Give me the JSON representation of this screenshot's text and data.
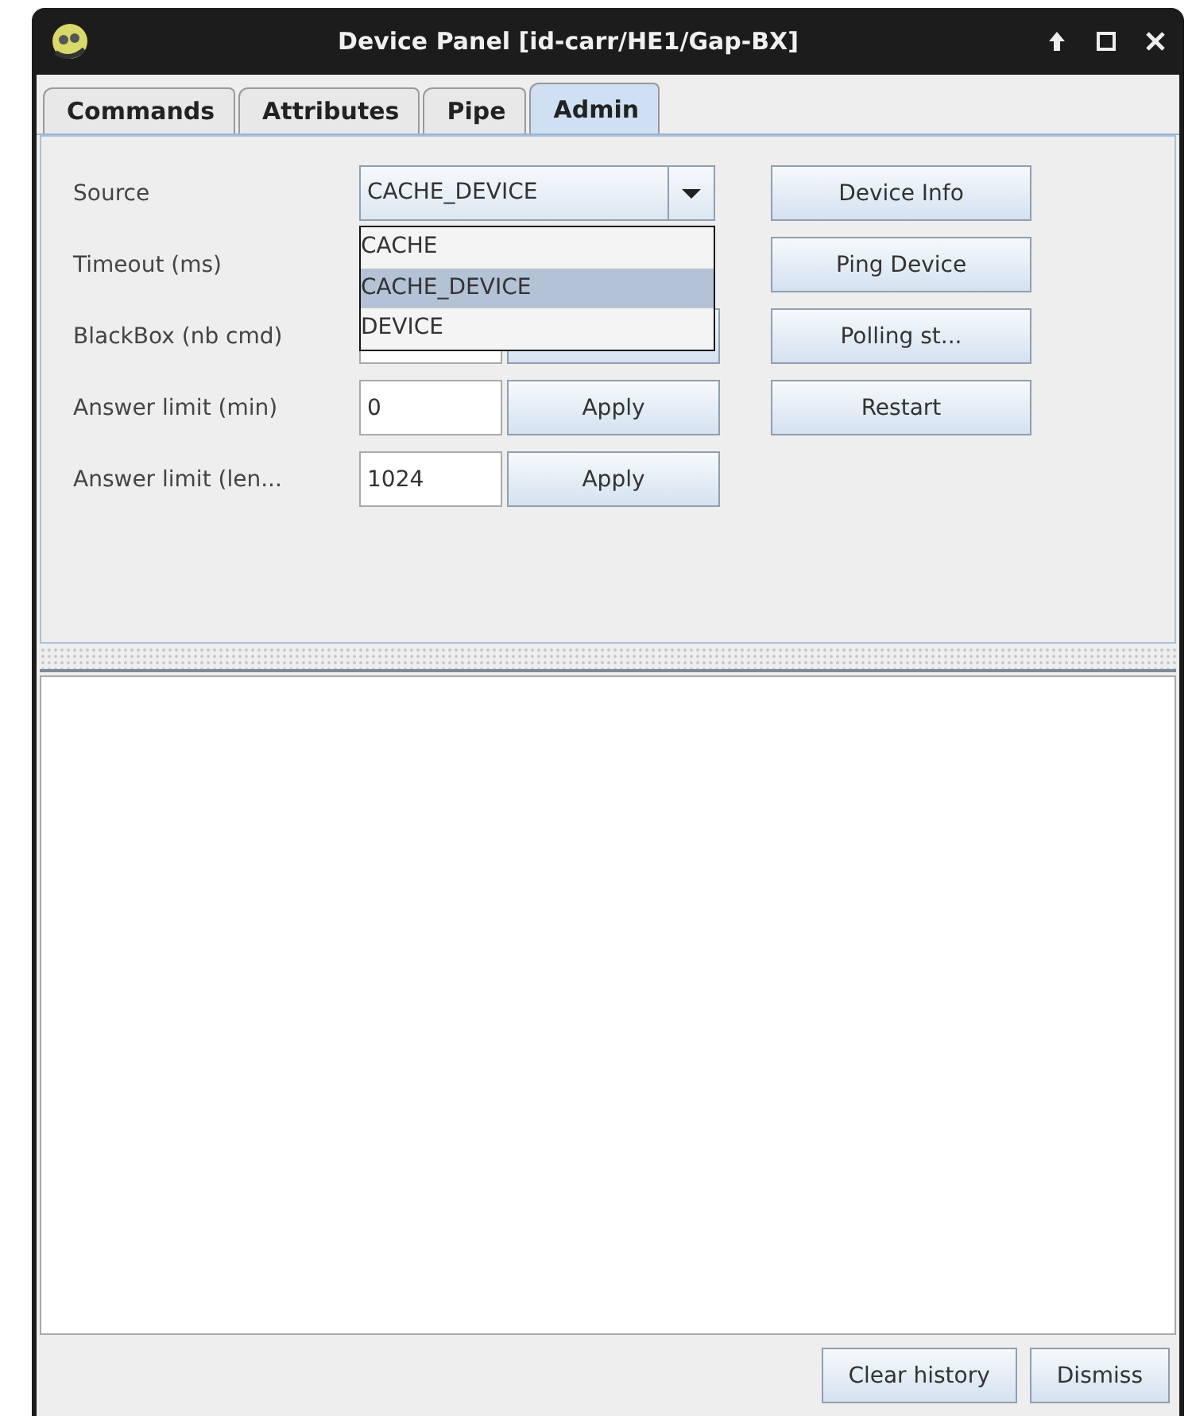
{
  "window": {
    "title": "Device Panel [id-carr/HE1/Gap-BX]"
  },
  "tabs": [
    {
      "label": "Commands",
      "selected": false
    },
    {
      "label": "Attributes",
      "selected": false
    },
    {
      "label": "Pipe",
      "selected": false
    },
    {
      "label": "Admin",
      "selected": true
    }
  ],
  "settings": [
    {
      "kind": "combo",
      "label": "Source",
      "value": "CACHE_DEVICE",
      "expanded": true,
      "options": [
        {
          "label": "CACHE",
          "selected": false
        },
        {
          "label": "CACHE_DEVICE",
          "selected": true
        },
        {
          "label": "DEVICE",
          "selected": false
        }
      ]
    },
    {
      "kind": "covered",
      "label": "Timeout (ms)"
    },
    {
      "kind": "partly_covered",
      "label": "BlackBox (nb cmd)"
    },
    {
      "kind": "field",
      "label": "Answer limit (min)",
      "value": "0",
      "button": "Apply"
    },
    {
      "kind": "field",
      "label": "Answer limit (len...",
      "value": "1024",
      "button": "Apply"
    }
  ],
  "actions": [
    "Device Info",
    "Ping Device",
    "Polling st...",
    "Restart"
  ],
  "footer_buttons": [
    "Clear history",
    "Dismiss"
  ]
}
